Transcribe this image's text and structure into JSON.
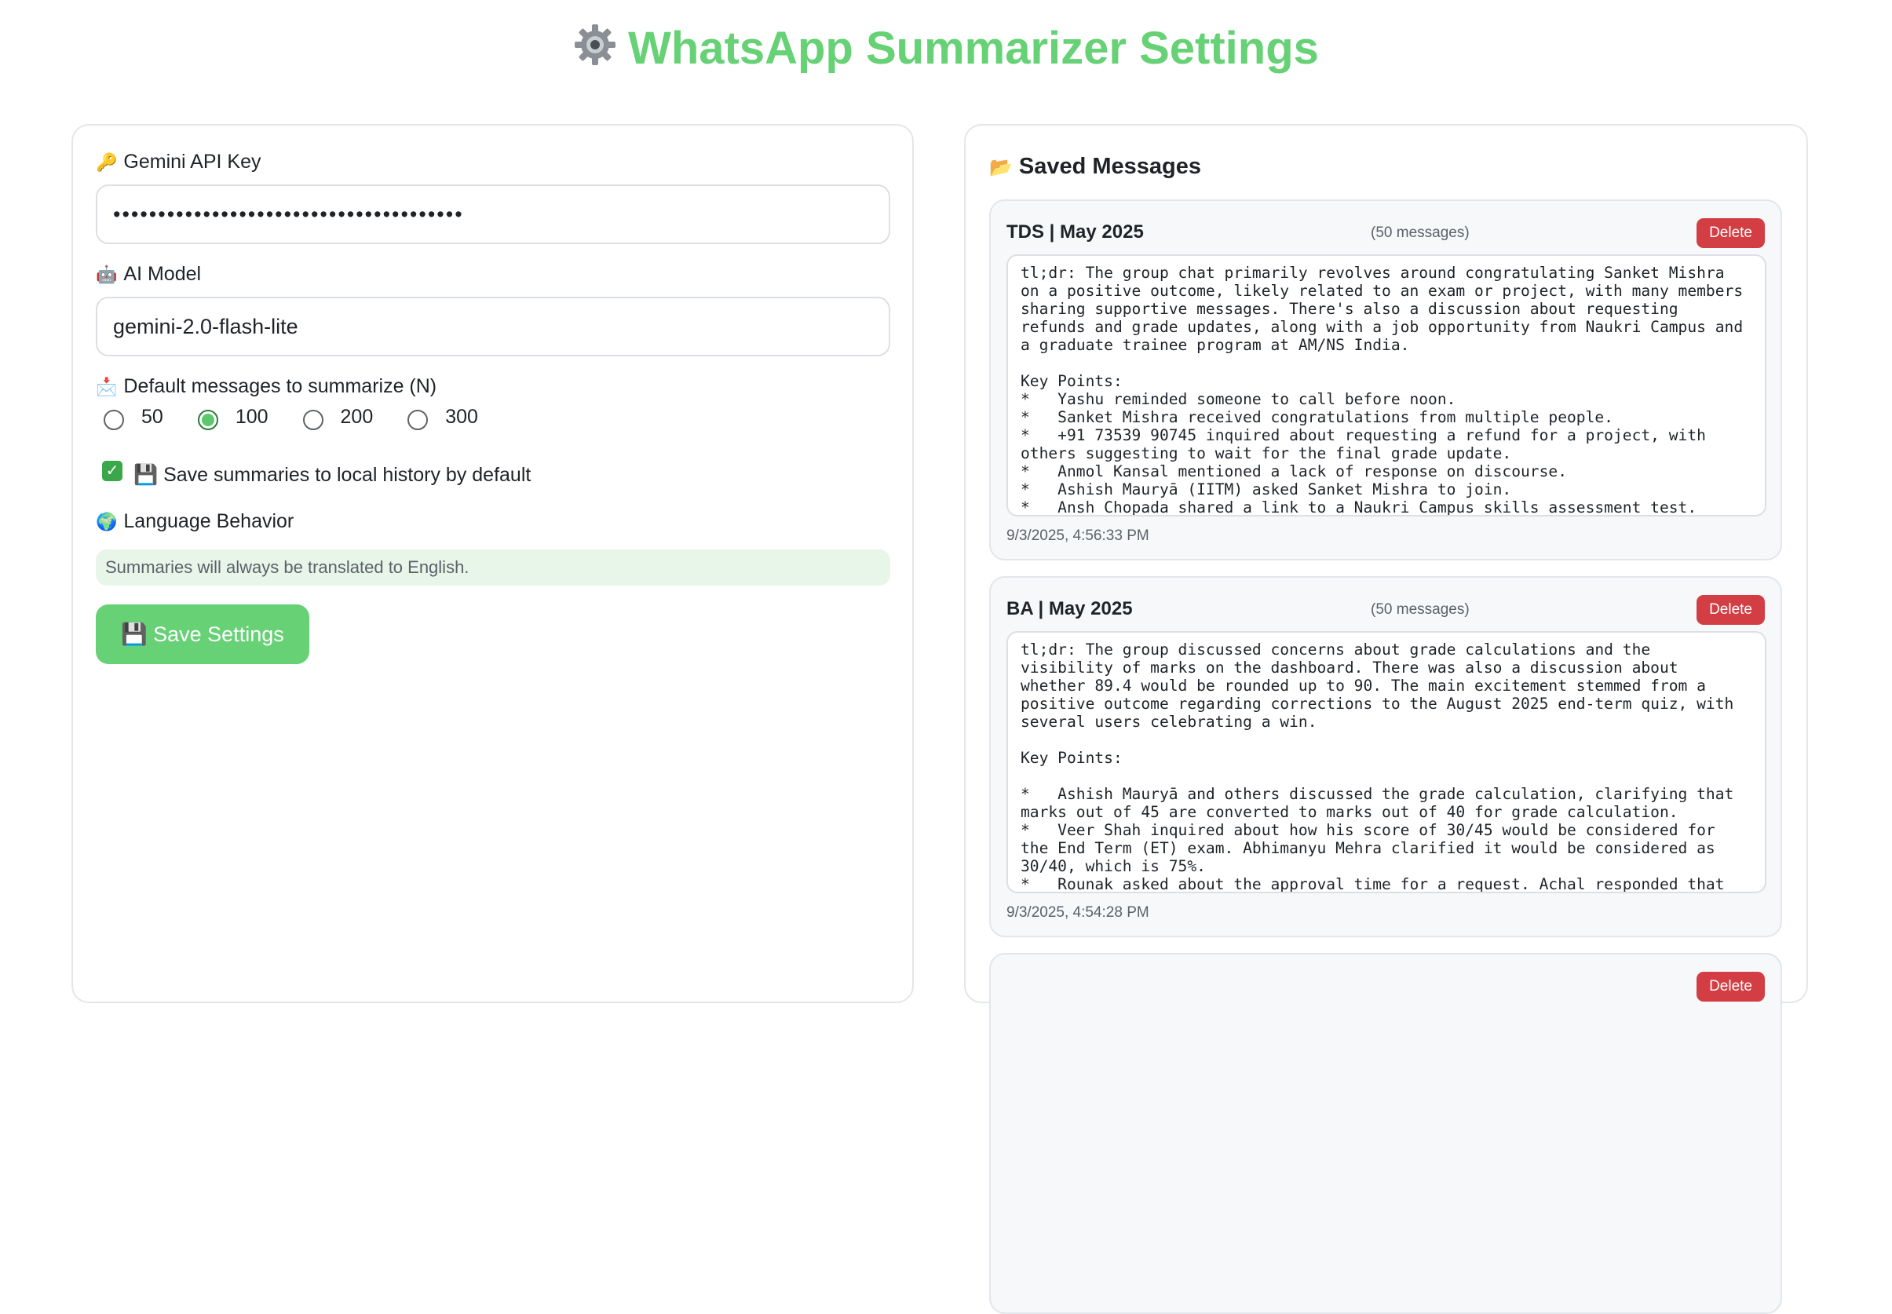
{
  "page": {
    "title": "WhatsApp Summarizer Settings",
    "title_icon": "gear-icon"
  },
  "settings": {
    "api_key_label": "Gemini API Key",
    "api_key_icon": "key-icon",
    "api_key_value": "•••••••••••••••••••••••••••••••••••••••",
    "model_label": "AI Model",
    "model_icon": "robot-icon",
    "model_value": "gemini-2.0-flash-lite",
    "default_n_label": "Default messages to summarize (N)",
    "default_n_icon": "inbox-icon",
    "n_options": [
      "50",
      "100",
      "200",
      "300"
    ],
    "n_selected": "100",
    "save_history_label": "💾 Save summaries to local history by default",
    "save_history_checked": true,
    "language_label": "Language Behavior",
    "language_icon": "globe-icon",
    "language_note": "Summaries will always be translated to English.",
    "save_button": "💾 Save Settings",
    "accent_color": "#66d175"
  },
  "saved": {
    "heading": "Saved Messages",
    "heading_icon": "folder-icon",
    "delete_label": "Delete",
    "items": [
      {
        "title": "TDS | May 2025",
        "count": "(50 messages)",
        "text": "tl;dr: The group chat primarily revolves around congratulating Sanket Mishra\non a positive outcome, likely related to an exam or project, with many members\nsharing supportive messages. There's also a discussion about requesting\nrefunds and grade updates, along with a job opportunity from Naukri Campus and\na graduate trainee program at AM/NS India.\n\nKey Points:\n*   Yashu reminded someone to call before noon.\n*   Sanket Mishra received congratulations from multiple people.\n*   +91 73539 90745 inquired about requesting a refund for a project, with\nothers suggesting to wait for the final grade update.\n*   Anmol Kansal mentioned a lack of response on discourse.\n*   Ashish Mauryā (IITM) asked Sanket Mishra to join.\n*   Ansh Chopada shared a link to a Naukri Campus skills assessment test.",
        "timestamp": "9/3/2025, 4:56:33 PM"
      },
      {
        "title": "BA | May 2025",
        "count": "(50 messages)",
        "text": "tl;dr: The group discussed concerns about grade calculations and the\nvisibility of marks on the dashboard. There was also a discussion about\nwhether 89.4 would be rounded up to 90. The main excitement stemmed from a\npositive outcome regarding corrections to the August 2025 end-term quiz, with\nseveral users celebrating a win.\n\nKey Points:\n\n*   Ashish Mauryā and others discussed the grade calculation, clarifying that\nmarks out of 45 are converted to marks out of 40 for grade calculation.\n*   Veer Shah inquired about how his score of 30/45 would be considered for\nthe End Term (ET) exam. Abhimanyu Mehra clarified it would be considered as\n30/40, which is 75%.\n*   Rounak asked about the approval time for a request. Achal responded that",
        "timestamp": "9/3/2025, 4:54:28 PM"
      }
    ]
  }
}
